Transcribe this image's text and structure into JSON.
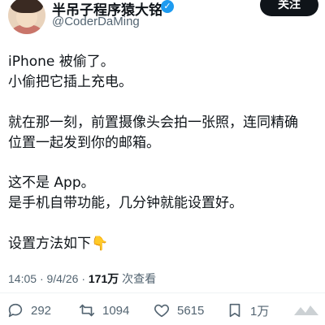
{
  "author": {
    "display_name": "半吊子程序猿大铭",
    "handle": "@CoderDaMing",
    "verified_icon": "verified-badge-icon"
  },
  "follow_label": "关注",
  "tweet": {
    "lines": [
      "iPhone 被偷了。",
      "小偷把它插上充电。",
      "就在那一刻，前置摄像头会拍一张照，连同精确",
      "位置一起发到你的邮箱。",
      "这不是 App。",
      "是手机自带功能，几分钟就能设置好。",
      "设置方法如下👇"
    ]
  },
  "meta": {
    "time": "14:05",
    "date": "9/4/26",
    "separator": "·",
    "views_count": "171万",
    "views_label": "次查看"
  },
  "actions": {
    "replies": "292",
    "retweets": "1094",
    "likes": "5615",
    "bookmarks": "1万"
  },
  "colors": {
    "accent": "#1d9bf0",
    "text": "#0f1419",
    "secondary": "#536471"
  }
}
